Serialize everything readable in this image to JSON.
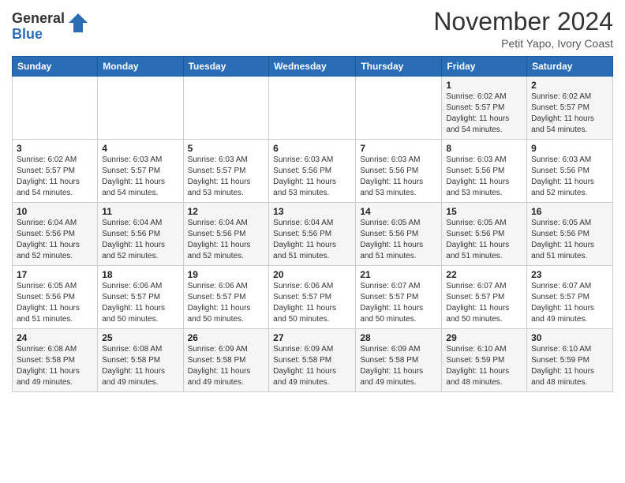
{
  "header": {
    "logo_general": "General",
    "logo_blue": "Blue",
    "month_title": "November 2024",
    "location": "Petit Yapo, Ivory Coast"
  },
  "calendar": {
    "days_of_week": [
      "Sunday",
      "Monday",
      "Tuesday",
      "Wednesday",
      "Thursday",
      "Friday",
      "Saturday"
    ],
    "weeks": [
      [
        {
          "day": "",
          "info": ""
        },
        {
          "day": "",
          "info": ""
        },
        {
          "day": "",
          "info": ""
        },
        {
          "day": "",
          "info": ""
        },
        {
          "day": "",
          "info": ""
        },
        {
          "day": "1",
          "info": "Sunrise: 6:02 AM\nSunset: 5:57 PM\nDaylight: 11 hours and 54 minutes."
        },
        {
          "day": "2",
          "info": "Sunrise: 6:02 AM\nSunset: 5:57 PM\nDaylight: 11 hours and 54 minutes."
        }
      ],
      [
        {
          "day": "3",
          "info": "Sunrise: 6:02 AM\nSunset: 5:57 PM\nDaylight: 11 hours and 54 minutes."
        },
        {
          "day": "4",
          "info": "Sunrise: 6:03 AM\nSunset: 5:57 PM\nDaylight: 11 hours and 54 minutes."
        },
        {
          "day": "5",
          "info": "Sunrise: 6:03 AM\nSunset: 5:57 PM\nDaylight: 11 hours and 53 minutes."
        },
        {
          "day": "6",
          "info": "Sunrise: 6:03 AM\nSunset: 5:56 PM\nDaylight: 11 hours and 53 minutes."
        },
        {
          "day": "7",
          "info": "Sunrise: 6:03 AM\nSunset: 5:56 PM\nDaylight: 11 hours and 53 minutes."
        },
        {
          "day": "8",
          "info": "Sunrise: 6:03 AM\nSunset: 5:56 PM\nDaylight: 11 hours and 53 minutes."
        },
        {
          "day": "9",
          "info": "Sunrise: 6:03 AM\nSunset: 5:56 PM\nDaylight: 11 hours and 52 minutes."
        }
      ],
      [
        {
          "day": "10",
          "info": "Sunrise: 6:04 AM\nSunset: 5:56 PM\nDaylight: 11 hours and 52 minutes."
        },
        {
          "day": "11",
          "info": "Sunrise: 6:04 AM\nSunset: 5:56 PM\nDaylight: 11 hours and 52 minutes."
        },
        {
          "day": "12",
          "info": "Sunrise: 6:04 AM\nSunset: 5:56 PM\nDaylight: 11 hours and 52 minutes."
        },
        {
          "day": "13",
          "info": "Sunrise: 6:04 AM\nSunset: 5:56 PM\nDaylight: 11 hours and 51 minutes."
        },
        {
          "day": "14",
          "info": "Sunrise: 6:05 AM\nSunset: 5:56 PM\nDaylight: 11 hours and 51 minutes."
        },
        {
          "day": "15",
          "info": "Sunrise: 6:05 AM\nSunset: 5:56 PM\nDaylight: 11 hours and 51 minutes."
        },
        {
          "day": "16",
          "info": "Sunrise: 6:05 AM\nSunset: 5:56 PM\nDaylight: 11 hours and 51 minutes."
        }
      ],
      [
        {
          "day": "17",
          "info": "Sunrise: 6:05 AM\nSunset: 5:56 PM\nDaylight: 11 hours and 51 minutes."
        },
        {
          "day": "18",
          "info": "Sunrise: 6:06 AM\nSunset: 5:57 PM\nDaylight: 11 hours and 50 minutes."
        },
        {
          "day": "19",
          "info": "Sunrise: 6:06 AM\nSunset: 5:57 PM\nDaylight: 11 hours and 50 minutes."
        },
        {
          "day": "20",
          "info": "Sunrise: 6:06 AM\nSunset: 5:57 PM\nDaylight: 11 hours and 50 minutes."
        },
        {
          "day": "21",
          "info": "Sunrise: 6:07 AM\nSunset: 5:57 PM\nDaylight: 11 hours and 50 minutes."
        },
        {
          "day": "22",
          "info": "Sunrise: 6:07 AM\nSunset: 5:57 PM\nDaylight: 11 hours and 50 minutes."
        },
        {
          "day": "23",
          "info": "Sunrise: 6:07 AM\nSunset: 5:57 PM\nDaylight: 11 hours and 49 minutes."
        }
      ],
      [
        {
          "day": "24",
          "info": "Sunrise: 6:08 AM\nSunset: 5:58 PM\nDaylight: 11 hours and 49 minutes."
        },
        {
          "day": "25",
          "info": "Sunrise: 6:08 AM\nSunset: 5:58 PM\nDaylight: 11 hours and 49 minutes."
        },
        {
          "day": "26",
          "info": "Sunrise: 6:09 AM\nSunset: 5:58 PM\nDaylight: 11 hours and 49 minutes."
        },
        {
          "day": "27",
          "info": "Sunrise: 6:09 AM\nSunset: 5:58 PM\nDaylight: 11 hours and 49 minutes."
        },
        {
          "day": "28",
          "info": "Sunrise: 6:09 AM\nSunset: 5:58 PM\nDaylight: 11 hours and 49 minutes."
        },
        {
          "day": "29",
          "info": "Sunrise: 6:10 AM\nSunset: 5:59 PM\nDaylight: 11 hours and 48 minutes."
        },
        {
          "day": "30",
          "info": "Sunrise: 6:10 AM\nSunset: 5:59 PM\nDaylight: 11 hours and 48 minutes."
        }
      ]
    ]
  }
}
